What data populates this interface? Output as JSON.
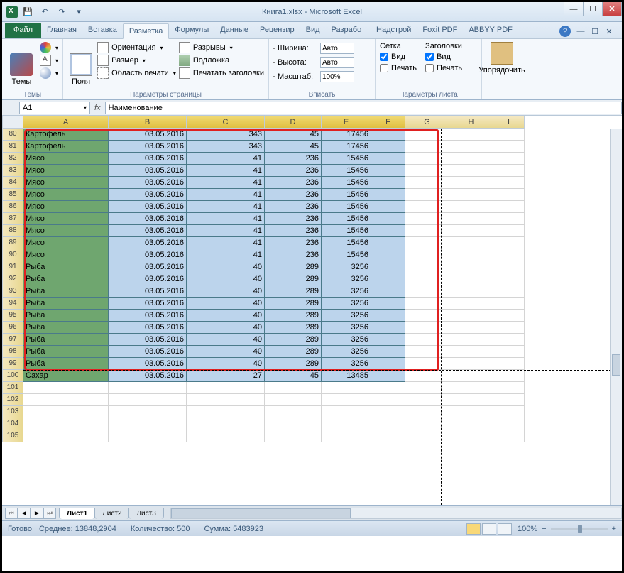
{
  "title": "Книга1.xlsx  -  Microsoft Excel",
  "qat": {
    "save": "💾",
    "undo": "↶",
    "redo": "↷"
  },
  "tabs": {
    "file": "Файл",
    "home": "Главная",
    "insert": "Вставка",
    "layout": "Разметка",
    "formulas": "Формулы",
    "data": "Данные",
    "review": "Рецензир",
    "view": "Вид",
    "dev": "Разработ",
    "addins": "Надстрой",
    "foxit": "Foxit PDF",
    "abbyy": "ABBYY PDF"
  },
  "ribbon": {
    "themes": {
      "btn": "Темы",
      "colors": "",
      "fonts": "",
      "effects": "",
      "group": "Темы"
    },
    "page": {
      "margins": "Поля",
      "orient": "Ориентация",
      "size": "Размер",
      "area": "Область печати",
      "breaks": "Разрывы",
      "bg": "Подложка",
      "titles": "Печатать заголовки",
      "group": "Параметры страницы"
    },
    "fit": {
      "width_lbl": "Ширина:",
      "width_val": "Авто",
      "height_lbl": "Высота:",
      "height_val": "Авто",
      "scale_lbl": "Масштаб:",
      "scale_val": "100%",
      "group": "Вписать"
    },
    "sheet": {
      "grid": "Сетка",
      "view": "Вид",
      "print": "Печать",
      "heads": "Заголовки",
      "group": "Параметры листа"
    },
    "arrange": {
      "btn": "Упорядочить"
    }
  },
  "namebox": "A1",
  "fx": "fx",
  "formula": "Наименование",
  "cols": [
    "A",
    "B",
    "C",
    "D",
    "E",
    "F",
    "G",
    "H",
    "I"
  ],
  "rows": [
    {
      "n": 80,
      "a": "Картофель",
      "b": "03.05.2016",
      "c": "343",
      "d": "45",
      "e": "17456"
    },
    {
      "n": 81,
      "a": "Картофель",
      "b": "03.05.2016",
      "c": "343",
      "d": "45",
      "e": "17456"
    },
    {
      "n": 82,
      "a": "Мясо",
      "b": "03.05.2016",
      "c": "41",
      "d": "236",
      "e": "15456"
    },
    {
      "n": 83,
      "a": "Мясо",
      "b": "03.05.2016",
      "c": "41",
      "d": "236",
      "e": "15456"
    },
    {
      "n": 84,
      "a": "Мясо",
      "b": "03.05.2016",
      "c": "41",
      "d": "236",
      "e": "15456"
    },
    {
      "n": 85,
      "a": "Мясо",
      "b": "03.05.2016",
      "c": "41",
      "d": "236",
      "e": "15456"
    },
    {
      "n": 86,
      "a": "Мясо",
      "b": "03.05.2016",
      "c": "41",
      "d": "236",
      "e": "15456"
    },
    {
      "n": 87,
      "a": "Мясо",
      "b": "03.05.2016",
      "c": "41",
      "d": "236",
      "e": "15456"
    },
    {
      "n": 88,
      "a": "Мясо",
      "b": "03.05.2016",
      "c": "41",
      "d": "236",
      "e": "15456"
    },
    {
      "n": 89,
      "a": "Мясо",
      "b": "03.05.2016",
      "c": "41",
      "d": "236",
      "e": "15456"
    },
    {
      "n": 90,
      "a": "Мясо",
      "b": "03.05.2016",
      "c": "41",
      "d": "236",
      "e": "15456"
    },
    {
      "n": 91,
      "a": "Рыба",
      "b": "03.05.2016",
      "c": "40",
      "d": "289",
      "e": "3256"
    },
    {
      "n": 92,
      "a": "Рыба",
      "b": "03.05.2016",
      "c": "40",
      "d": "289",
      "e": "3256"
    },
    {
      "n": 93,
      "a": "Рыба",
      "b": "03.05.2016",
      "c": "40",
      "d": "289",
      "e": "3256"
    },
    {
      "n": 94,
      "a": "Рыба",
      "b": "03.05.2016",
      "c": "40",
      "d": "289",
      "e": "3256"
    },
    {
      "n": 95,
      "a": "Рыба",
      "b": "03.05.2016",
      "c": "40",
      "d": "289",
      "e": "3256"
    },
    {
      "n": 96,
      "a": "Рыба",
      "b": "03.05.2016",
      "c": "40",
      "d": "289",
      "e": "3256"
    },
    {
      "n": 97,
      "a": "Рыба",
      "b": "03.05.2016",
      "c": "40",
      "d": "289",
      "e": "3256"
    },
    {
      "n": 98,
      "a": "Рыба",
      "b": "03.05.2016",
      "c": "40",
      "d": "289",
      "e": "3256"
    },
    {
      "n": 99,
      "a": "Рыба",
      "b": "03.05.2016",
      "c": "40",
      "d": "289",
      "e": "3256"
    },
    {
      "n": 100,
      "a": "Сахар",
      "b": "03.05.2016",
      "c": "27",
      "d": "45",
      "e": "13485"
    }
  ],
  "empty_rows": [
    101,
    102,
    103,
    104,
    105
  ],
  "sheets": {
    "s1": "Лист1",
    "s2": "Лист2",
    "s3": "Лист3"
  },
  "status": {
    "ready": "Готово",
    "avg_lbl": "Среднее:",
    "avg": "13848,2904",
    "cnt_lbl": "Количество:",
    "cnt": "500",
    "sum_lbl": "Сумма:",
    "sum": "5483923",
    "zoom": "100%"
  },
  "wc": {
    "min": "—",
    "max": "☐",
    "close": "✕",
    "drop": "▾"
  }
}
